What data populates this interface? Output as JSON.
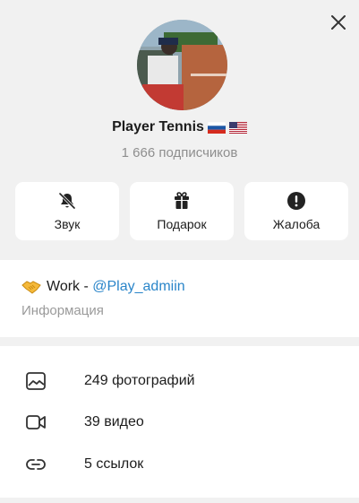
{
  "profile": {
    "name": "Player Tennis",
    "subscribers": "1 666 подписчиков"
  },
  "actions": [
    {
      "label": "Звук",
      "icon": "bell-muted-icon"
    },
    {
      "label": "Подарок",
      "icon": "gift-icon"
    },
    {
      "label": "Жалоба",
      "icon": "exclamation-circle-icon"
    }
  ],
  "info": {
    "prefix": "Work - ",
    "link": "@Play_admiin",
    "caption": "Информация"
  },
  "media": [
    {
      "label": "249 фотографий",
      "icon": "photo-icon"
    },
    {
      "label": "39 видео",
      "icon": "video-icon"
    },
    {
      "label": "5 ссылок",
      "icon": "link-icon"
    }
  ],
  "colors": {
    "background": "#f1f1f1",
    "card": "#ffffff",
    "link": "#2a85c9",
    "muted": "#8e8e8e"
  }
}
